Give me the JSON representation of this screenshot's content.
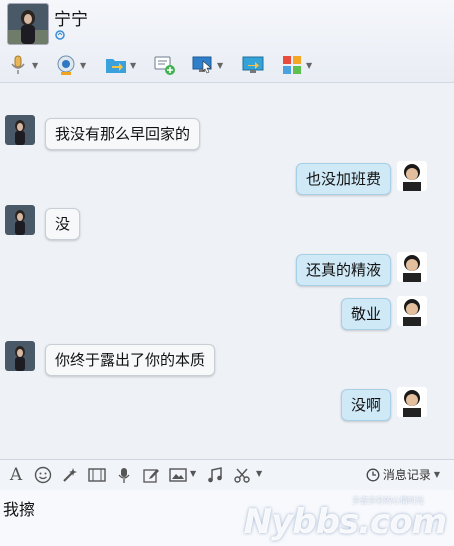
{
  "contact": {
    "name": "宁宁"
  },
  "toolbar": {
    "items": [
      {
        "icon": "microphone-icon"
      },
      {
        "icon": "webcam-icon"
      },
      {
        "icon": "send-file-icon"
      },
      {
        "icon": "add-message-icon"
      },
      {
        "icon": "remote-assist-icon"
      },
      {
        "icon": "screen-share-icon"
      },
      {
        "icon": "app-grid-icon"
      }
    ]
  },
  "messages": [
    {
      "side": "left",
      "text": "我没有那么早回家的"
    },
    {
      "side": "right",
      "text": "也没加班费"
    },
    {
      "side": "left",
      "text": "没"
    },
    {
      "side": "right",
      "text": "还真的精液"
    },
    {
      "side": "right",
      "text": "敬业"
    },
    {
      "side": "left",
      "text": "你终于露出了你的本质"
    },
    {
      "side": "right",
      "text": "没啊"
    }
  ],
  "input_toolbar": {
    "icons": [
      "font-icon",
      "emoji-icon",
      "magic-icon",
      "video-clip-icon",
      "voice-icon",
      "edit-icon",
      "image-icon",
      "music-icon",
      "screenshot-icon"
    ],
    "history_label": "消息记录"
  },
  "input": {
    "value": "我擦"
  },
  "watermark": {
    "text": "Nybbs.com",
    "sub": "多姿多彩的心情时光"
  }
}
